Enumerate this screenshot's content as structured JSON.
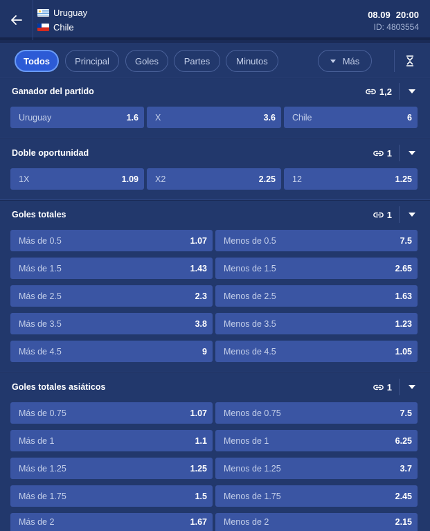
{
  "header": {
    "team_home": "Uruguay",
    "team_away": "Chile",
    "date": "08.09",
    "time": "20:00",
    "event_id": "ID: 4803554"
  },
  "filters": {
    "tabs": [
      "Todos",
      "Principal",
      "Goles",
      "Partes",
      "Minutos"
    ],
    "active": "Todos",
    "more_label": "Más"
  },
  "markets": [
    {
      "title": "Ganador del partido",
      "link_count": "1,2",
      "rows": [
        [
          {
            "label": "Uruguay",
            "odd": "1.6"
          },
          {
            "label": "X",
            "odd": "3.6"
          },
          {
            "label": "Chile",
            "odd": "6"
          }
        ]
      ]
    },
    {
      "title": "Doble oportunidad",
      "link_count": "1",
      "rows": [
        [
          {
            "label": "1X",
            "odd": "1.09"
          },
          {
            "label": "X2",
            "odd": "2.25"
          },
          {
            "label": "12",
            "odd": "1.25"
          }
        ]
      ]
    },
    {
      "title": "Goles totales",
      "link_count": "1",
      "rows": [
        [
          {
            "label": "Más de 0.5",
            "odd": "1.07"
          },
          {
            "label": "Menos de 0.5",
            "odd": "7.5"
          }
        ],
        [
          {
            "label": "Más de 1.5",
            "odd": "1.43"
          },
          {
            "label": "Menos de 1.5",
            "odd": "2.65"
          }
        ],
        [
          {
            "label": "Más de 2.5",
            "odd": "2.3"
          },
          {
            "label": "Menos de 2.5",
            "odd": "1.63"
          }
        ],
        [
          {
            "label": "Más de 3.5",
            "odd": "3.8"
          },
          {
            "label": "Menos de 3.5",
            "odd": "1.23"
          }
        ],
        [
          {
            "label": "Más de 4.5",
            "odd": "9"
          },
          {
            "label": "Menos de 4.5",
            "odd": "1.05"
          }
        ]
      ]
    },
    {
      "title": "Goles totales asiáticos",
      "link_count": "1",
      "rows": [
        [
          {
            "label": "Más de 0.75",
            "odd": "1.07"
          },
          {
            "label": "Menos de 0.75",
            "odd": "7.5"
          }
        ],
        [
          {
            "label": "Más de 1",
            "odd": "1.1"
          },
          {
            "label": "Menos de 1",
            "odd": "6.25"
          }
        ],
        [
          {
            "label": "Más de 1.25",
            "odd": "1.25"
          },
          {
            "label": "Menos de 1.25",
            "odd": "3.7"
          }
        ],
        [
          {
            "label": "Más de 1.75",
            "odd": "1.5"
          },
          {
            "label": "Menos de 1.75",
            "odd": "2.45"
          }
        ],
        [
          {
            "label": "Más de 2",
            "odd": "1.67"
          },
          {
            "label": "Menos de 2",
            "odd": "2.15"
          }
        ]
      ]
    }
  ]
}
